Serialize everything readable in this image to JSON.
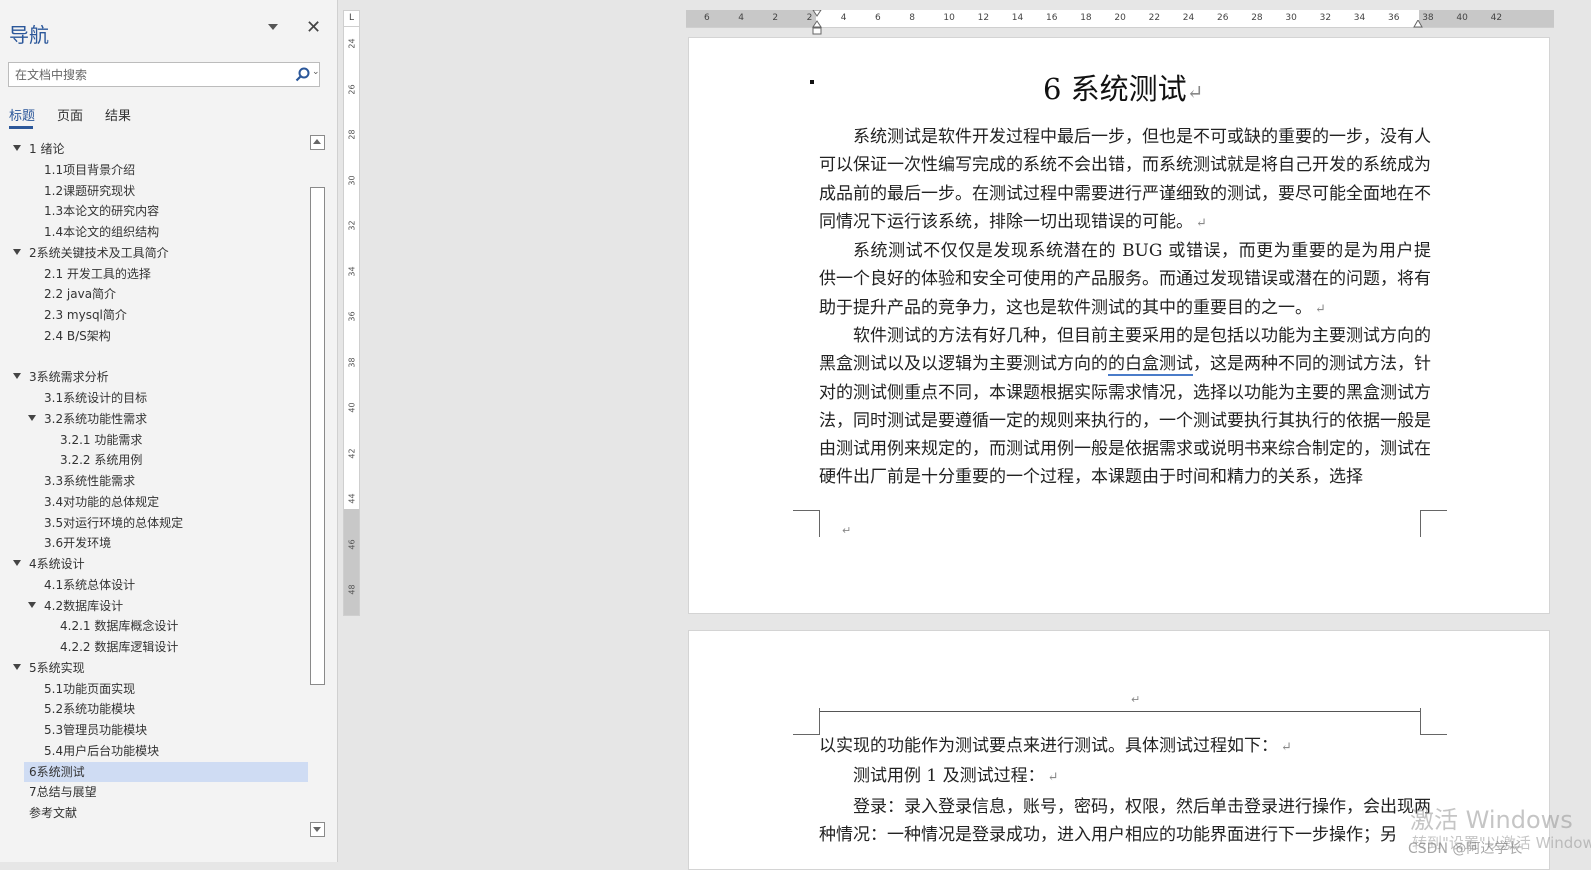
{
  "nav": {
    "title": "导航",
    "search_placeholder": "在文档中搜索",
    "tabs": [
      "标题",
      "页面",
      "结果"
    ],
    "outline": [
      {
        "label": "1 绪论",
        "level": 1,
        "expanded": true
      },
      {
        "label": "1.1项目背景介绍",
        "level": 2
      },
      {
        "label": "1.2课题研究现状",
        "level": 2
      },
      {
        "label": "1.3本论文的研究内容",
        "level": 2
      },
      {
        "label": "1.4本论文的组织结构",
        "level": 2
      },
      {
        "label": "2系统关键技术及工具简介",
        "level": 1,
        "expanded": true
      },
      {
        "label": "2.1 开发工具的选择",
        "level": 2
      },
      {
        "label": "2.2 java简介",
        "level": 2
      },
      {
        "label": "2.3 mysql简介",
        "level": 2
      },
      {
        "label": "2.4 B/S架构",
        "level": 2
      },
      {
        "label": "",
        "level": 2
      },
      {
        "label": "3系统需求分析",
        "level": 1,
        "expanded": true
      },
      {
        "label": "3.1系统设计的目标",
        "level": 2
      },
      {
        "label": "3.2系统功能性需求",
        "level": 2,
        "expanded": true
      },
      {
        "label": "3.2.1 功能需求",
        "level": 3
      },
      {
        "label": "3.2.2 系统用例",
        "level": 3
      },
      {
        "label": "3.3系统性能需求",
        "level": 2
      },
      {
        "label": "3.4对功能的总体规定",
        "level": 2
      },
      {
        "label": "3.5对运行环境的总体规定",
        "level": 2
      },
      {
        "label": "3.6开发环境",
        "level": 2
      },
      {
        "label": "4系统设计",
        "level": 1,
        "expanded": true
      },
      {
        "label": "4.1系统总体设计",
        "level": 2
      },
      {
        "label": "4.2数据库设计",
        "level": 2,
        "expanded": true
      },
      {
        "label": "4.2.1 数据库概念设计",
        "level": 3
      },
      {
        "label": "4.2.2 数据库逻辑设计",
        "level": 3
      },
      {
        "label": "5系统实现",
        "level": 1,
        "expanded": true
      },
      {
        "label": "5.1功能页面实现",
        "level": 2
      },
      {
        "label": "5.2系统功能模块",
        "level": 2
      },
      {
        "label": "5.3管理员功能模块",
        "level": 2
      },
      {
        "label": "5.4用户后台功能模块",
        "level": 2
      },
      {
        "label": "6系统测试",
        "level": 1,
        "selected": true
      },
      {
        "label": "7总结与展望",
        "level": 1
      },
      {
        "label": "参考文献",
        "level": 1
      }
    ]
  },
  "ruler": {
    "corner": "L",
    "h_labels": [
      "6",
      "4",
      "2",
      "2",
      "4",
      "6",
      "8",
      "10",
      "12",
      "14",
      "16",
      "18",
      "20",
      "22",
      "24",
      "26",
      "28",
      "30",
      "32",
      "34",
      "36",
      "38",
      "40",
      "42"
    ],
    "v_labels": [
      "24",
      "26",
      "28",
      "30",
      "32",
      "34",
      "36",
      "38",
      "40",
      "42",
      "44",
      "46",
      "48"
    ]
  },
  "page1": {
    "heading": "6 系统测试",
    "paragraphs": [
      "系统测试是软件开发过程中最后一步，但也是不可或缺的重要的一步，没有人可以保证一次性编写完成的系统不会出错，而系统测试就是将自己开发的系统成为成品前的最后一步。在测试过程中需要进行严谨细致的测试，要尽可能全面地在不同情况下运行该系统，排除一切出现错误的可能。",
      "系统测试不仅仅是发现系统潜在的 BUG 或错误，而更为重要的是为用户提供一个良好的体验和安全可使用的产品服务。而通过发现错误或潜在的问题，将有助于提升产品的竞争力，这也是软件测试的其中的重要目的之一。"
    ],
    "para3_before": "软件测试的方法有好几种，但目前主要采用的是包括以功能为主要测试方向的黑盒测试以及以逻辑为主要测试方向的",
    "para3_underlined": "的白盒测试",
    "para3_after": "，这是两种不同的测试方法，针对的测试侧重点不同，本课题根据实际需求情况，选择以功能为主要的黑盒测试方法，同时测试是要遵循一定的规则来执行的，一个测试要执行其执行的依据一般是由测试用例来规定的，而测试用例一般是依据需求或说明书来综合制定的，测试在硬件出厂前是十分重要的一个过程，本课题由于时间和精力的关系，选择"
  },
  "page2": {
    "line1": "以实现的功能作为测试要点来进行测试。具体测试过程如下：",
    "line2": "测试用例 1 及测试过程：",
    "line3": "登录：录入登录信息，账号，密码，权限，然后单击登录进行操作，会出现两种情况：一种情况是登录成功，进入用户相应的功能界面进行下一步操作；另"
  },
  "para_mark": "↵",
  "watermark": {
    "line1": "激活 Windows",
    "line2": "转到\"设置\"以激活 Windows。",
    "csdn": "CSDN @阿达学长"
  }
}
